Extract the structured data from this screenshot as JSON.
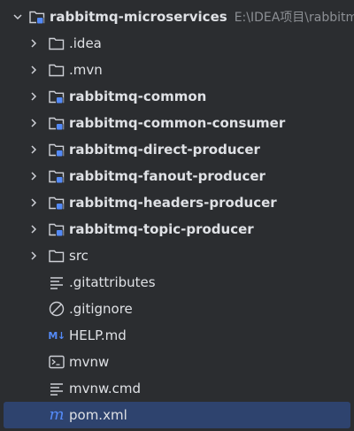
{
  "project": {
    "name": "rabbitmq-microservices",
    "path": "E:\\IDEA项目\\rabbitm"
  },
  "items": [
    {
      "label": ".idea"
    },
    {
      "label": ".mvn"
    },
    {
      "label": "rabbitmq-common"
    },
    {
      "label": "rabbitmq-common-consumer"
    },
    {
      "label": "rabbitmq-direct-producer"
    },
    {
      "label": "rabbitmq-fanout-producer"
    },
    {
      "label": "rabbitmq-headers-producer"
    },
    {
      "label": "rabbitmq-topic-producer"
    },
    {
      "label": "src"
    },
    {
      "label": ".gitattributes"
    },
    {
      "label": ".gitignore"
    },
    {
      "label": "HELP.md"
    },
    {
      "label": "mvnw"
    },
    {
      "label": "mvnw.cmd"
    },
    {
      "label": "pom.xml"
    }
  ],
  "icons": {
    "markdown_text": "M↓",
    "maven_text": "m"
  },
  "colors": {
    "background": "#2b2d30",
    "selection": "#2e436e",
    "module_badge": "#548af7",
    "text": "#dfe1e5",
    "path_text": "#8c8f94"
  }
}
